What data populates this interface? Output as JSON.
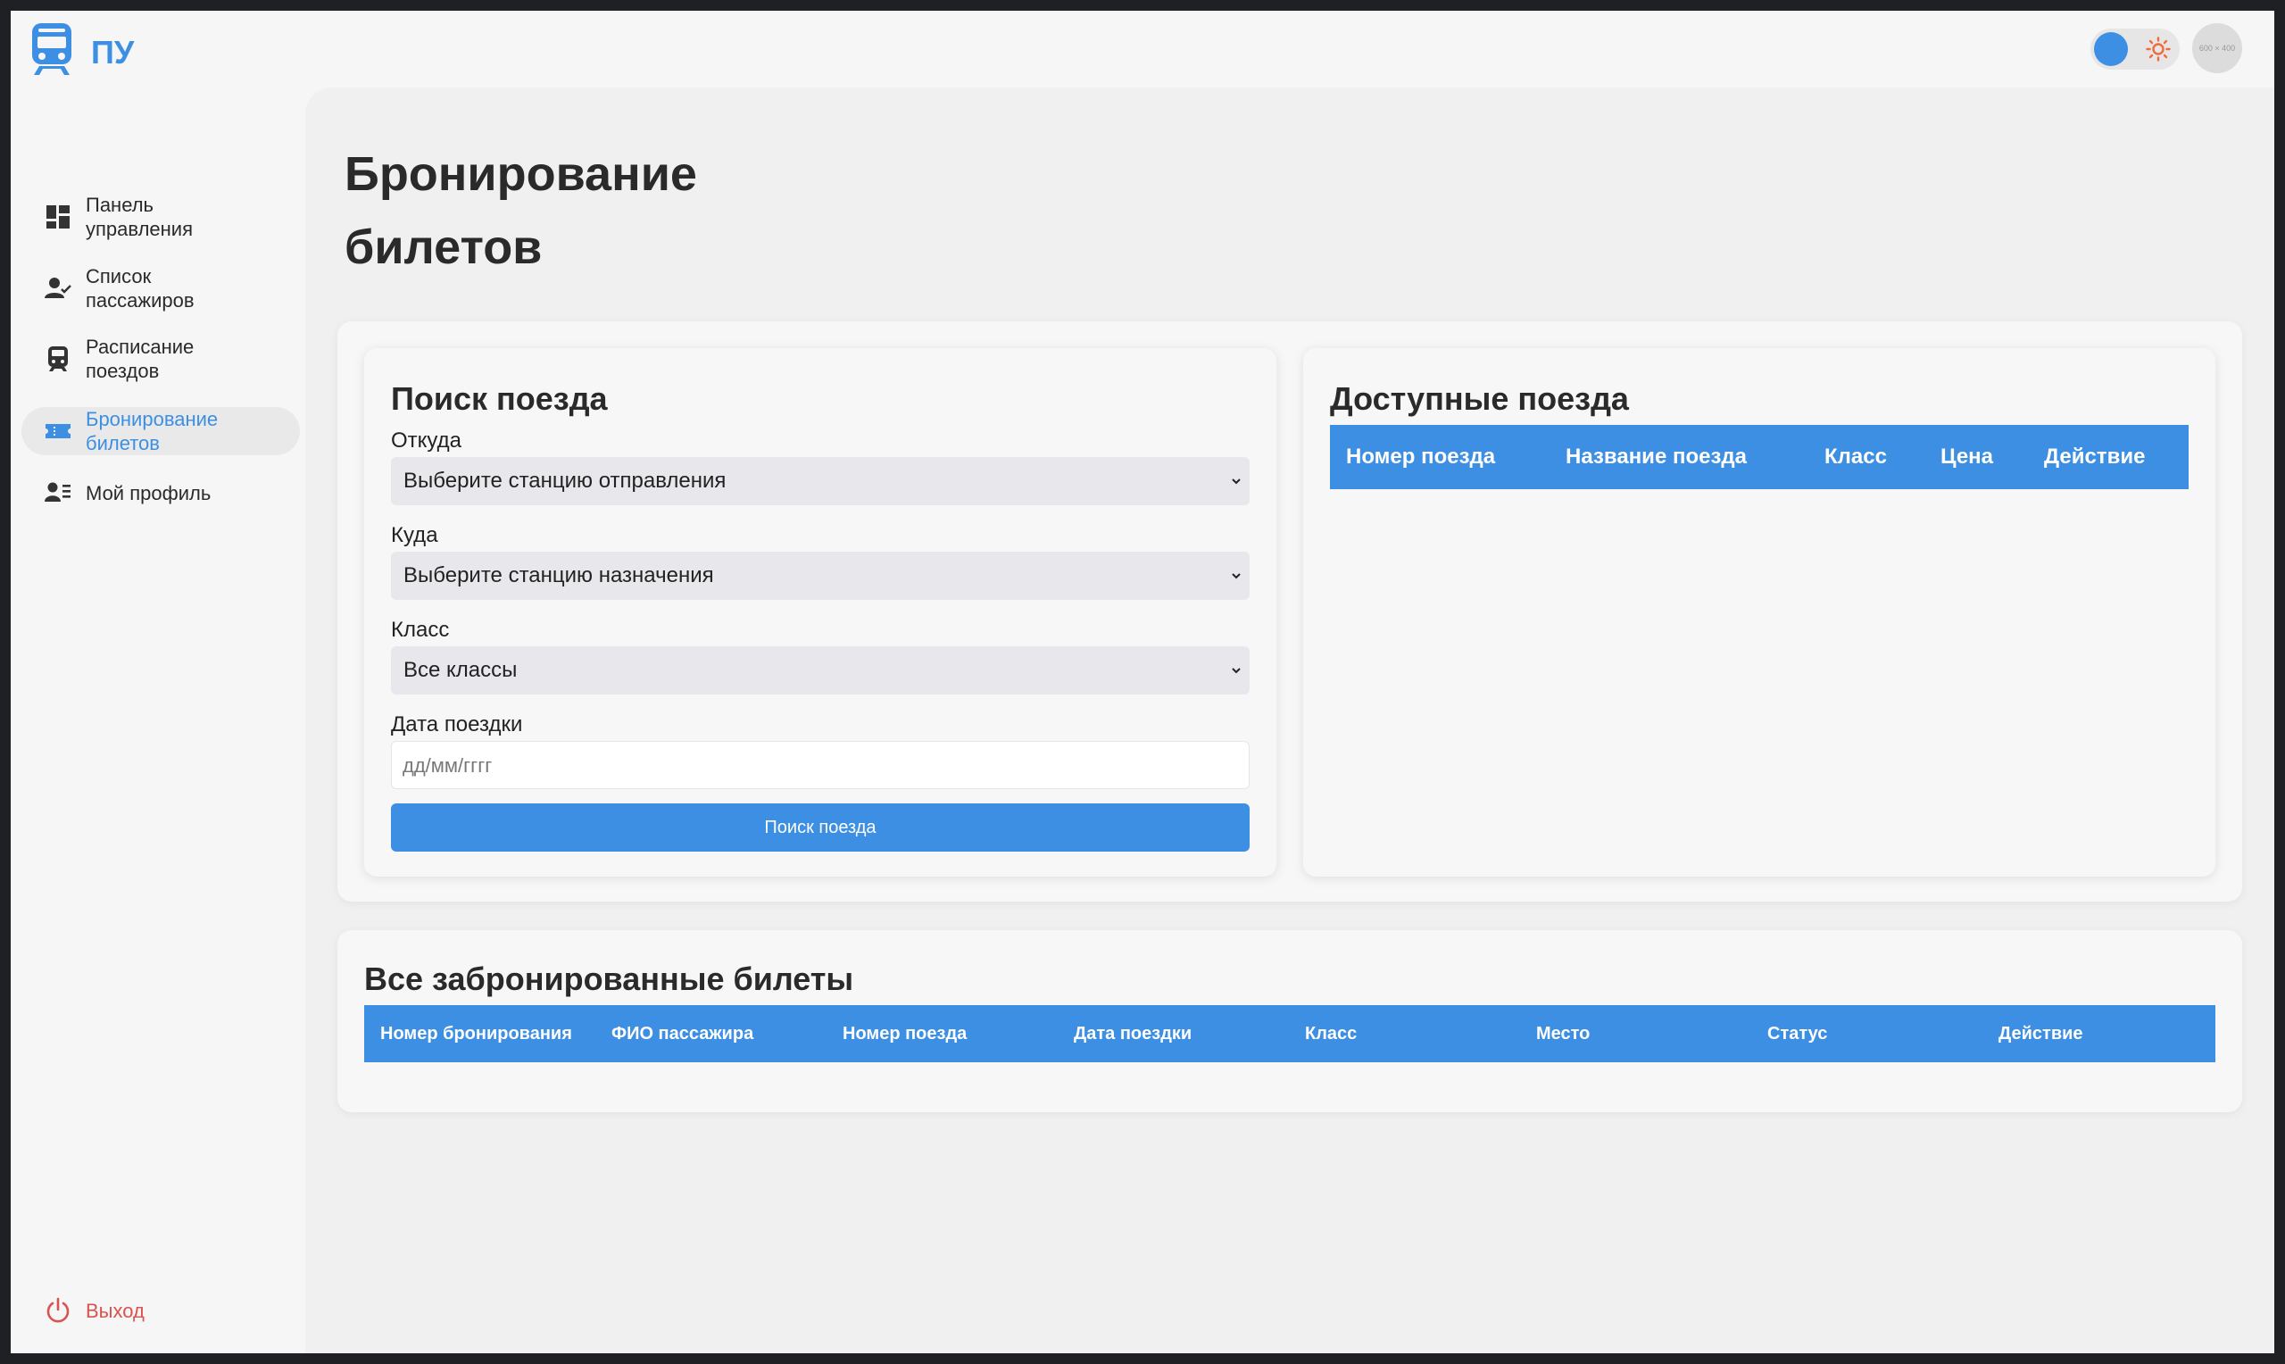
{
  "app": {
    "brand": "ПУ",
    "avatar_text": "600 × 400"
  },
  "theme": {
    "accent": "#3d8fe3",
    "logout_color": "#d9534f",
    "sun_color": "#f26b3a"
  },
  "sidebar": {
    "items": [
      {
        "label": "Панель управления",
        "icon": "dashboard-icon"
      },
      {
        "label": "Список пассажиров",
        "icon": "user-check-icon"
      },
      {
        "label": "Расписание поездов",
        "icon": "train-icon"
      },
      {
        "label": "Бронирование билетов",
        "icon": "ticket-icon",
        "active": true
      },
      {
        "label": "Мой профиль",
        "icon": "profile-icon"
      }
    ],
    "logout": "Выход"
  },
  "main": {
    "page_title": "Бронирование билетов",
    "search": {
      "title": "Поиск поезда",
      "from_label": "Откуда",
      "from_value": "Выберите станцию отправления",
      "to_label": "Куда",
      "to_value": "Выберите станцию назначения",
      "class_label": "Класс",
      "class_value": "Все классы",
      "date_label": "Дата поездки",
      "date_placeholder": "дд/мм/гггг",
      "button": "Поиск поезда"
    },
    "available": {
      "title": "Доступные поезда",
      "columns": [
        "Номер поезда",
        "Название поезда",
        "Класс",
        "Цена",
        "Действие"
      ]
    },
    "booked": {
      "title": "Все забронированные билеты",
      "columns": [
        "Номер бронирования",
        "ФИО пассажира",
        "Номер поезда",
        "Дата поездки",
        "Класс",
        "Место",
        "Статус",
        "Действие"
      ]
    }
  }
}
